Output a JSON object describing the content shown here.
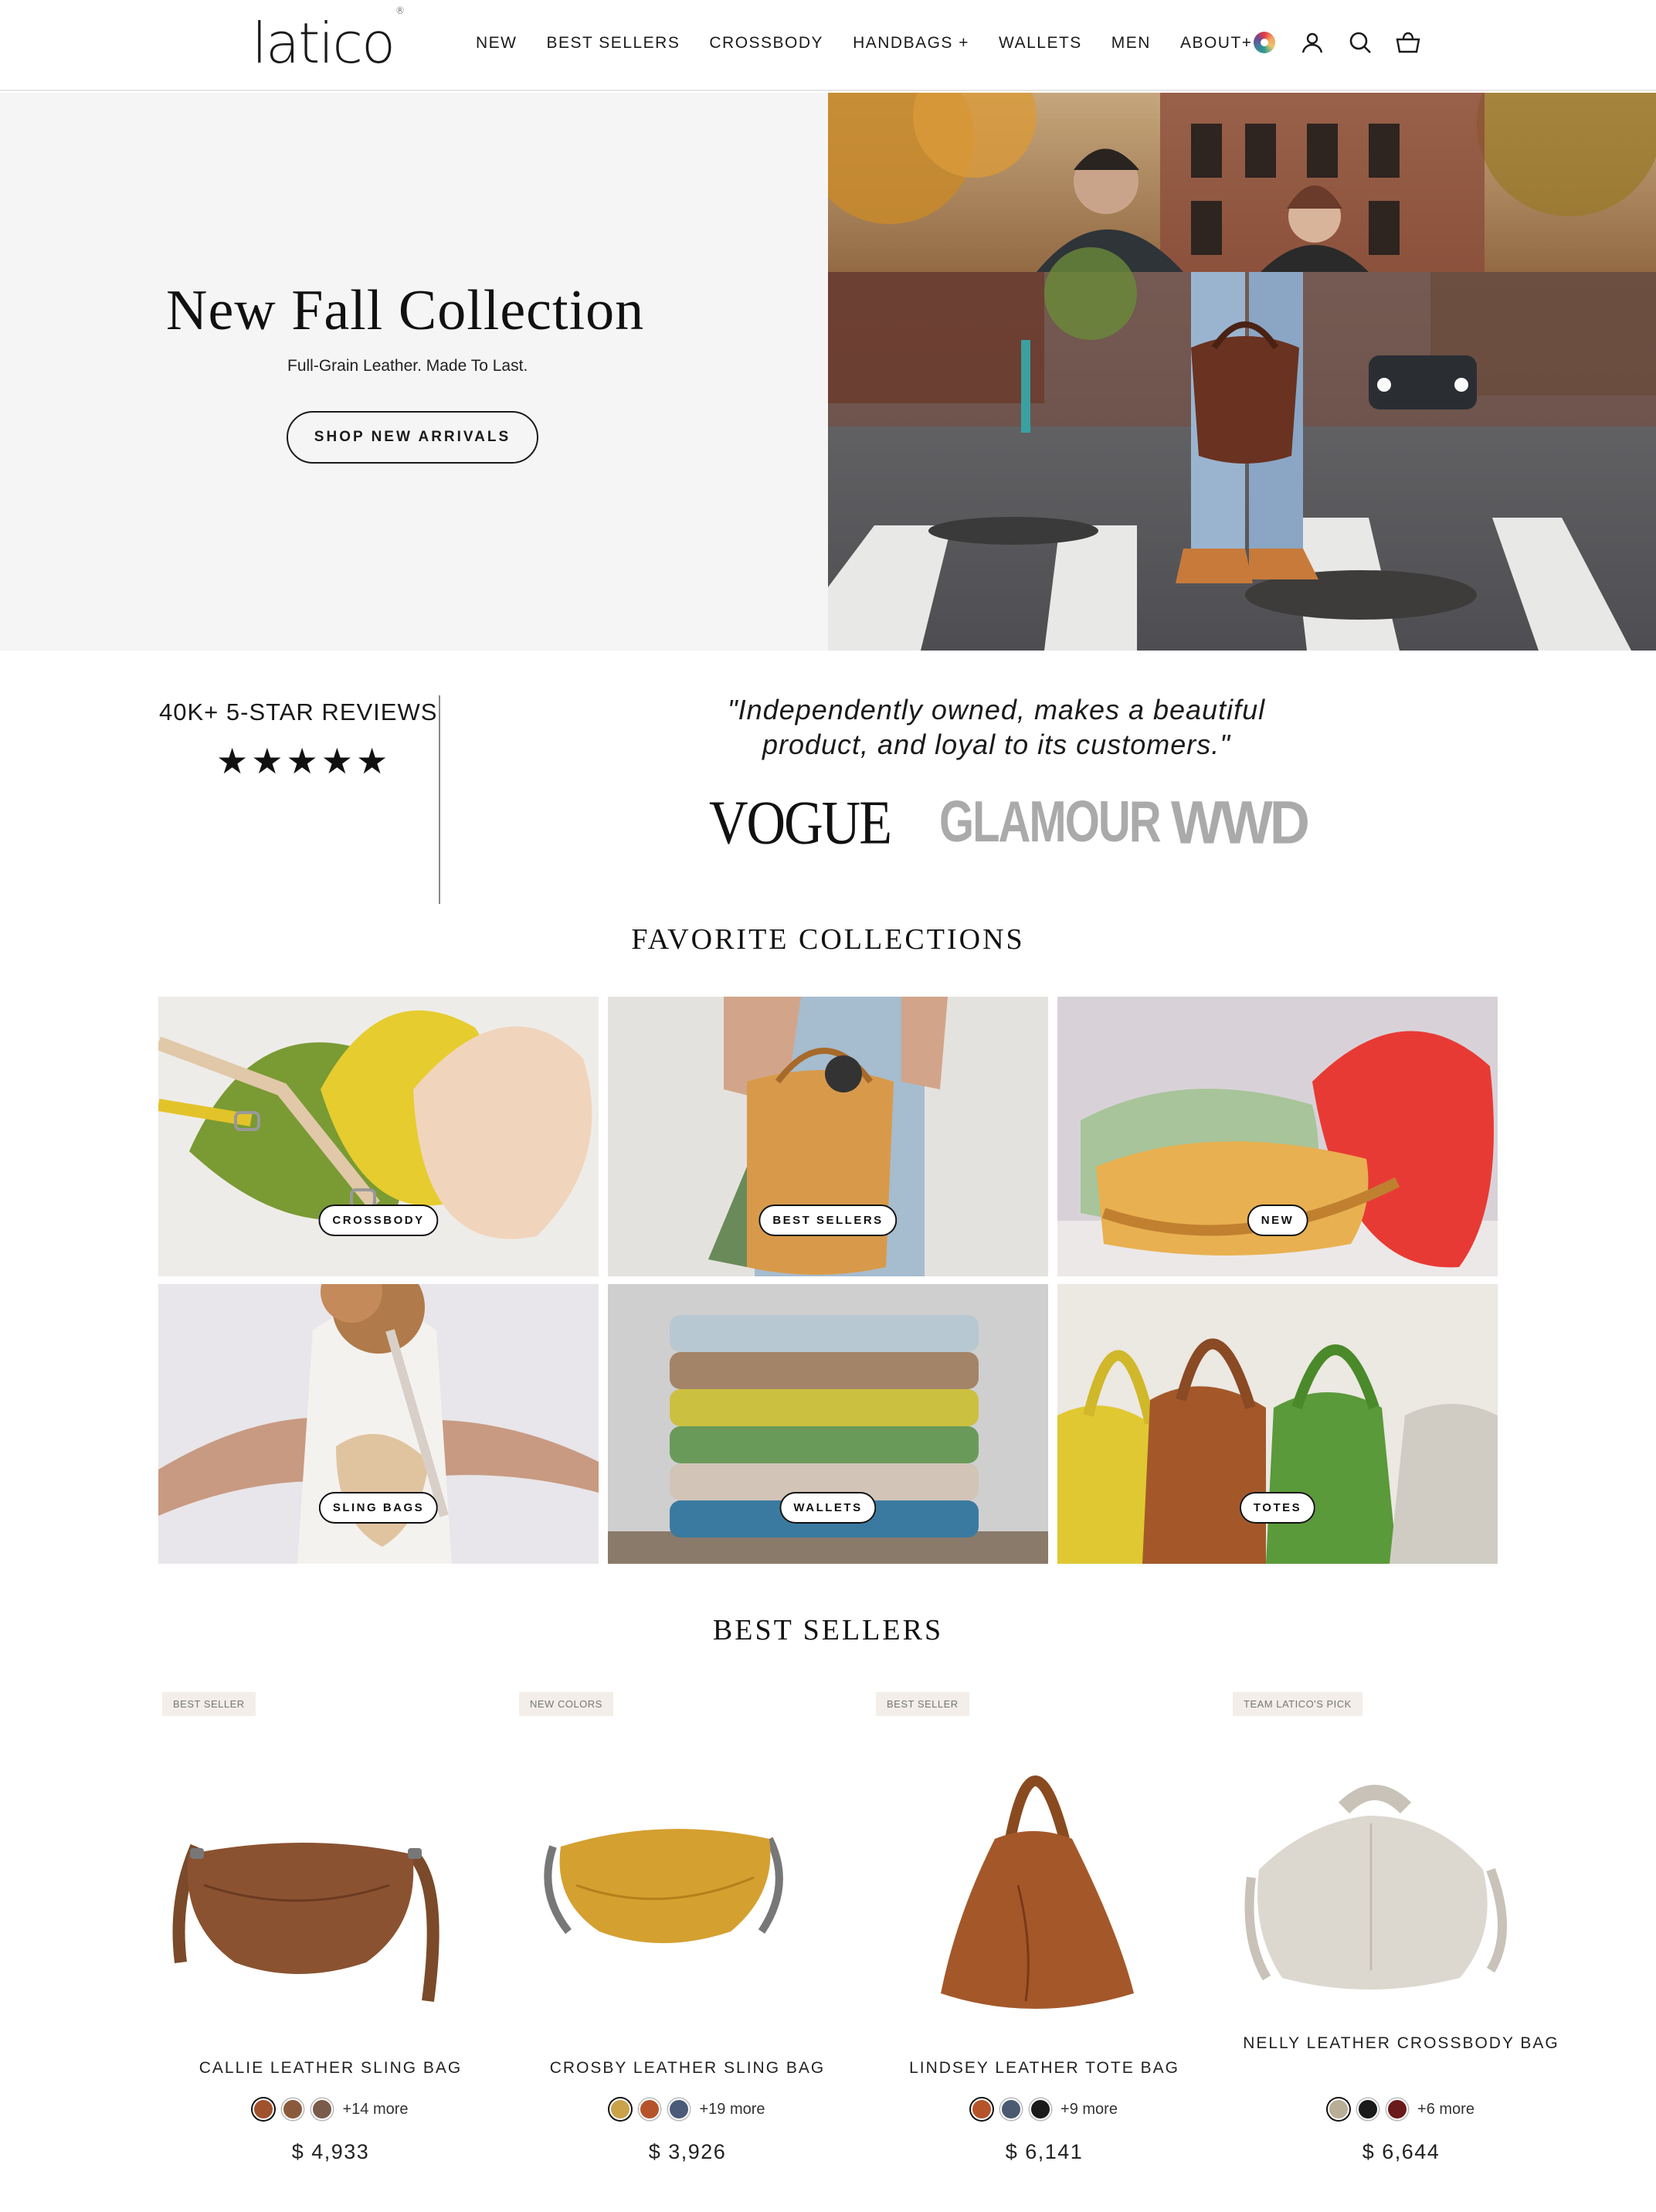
{
  "header": {
    "logo": "latico",
    "logo_mark": "®",
    "nav": [
      "NEW",
      "BEST SELLERS",
      "CROSSBODY",
      "HANDBAGS +",
      "WALLETS",
      "MEN",
      "ABOUT+"
    ],
    "icons": [
      "color-wheel-icon",
      "account-icon",
      "search-icon",
      "cart-icon"
    ]
  },
  "hero": {
    "title": "New Fall Collection",
    "subtitle": "Full-Grain Leather. Made To Last.",
    "cta": "SHOP NEW ARRIVALS"
  },
  "press": {
    "reviews": "40K+ 5-STAR REVIEWS",
    "stars": "★★★★★",
    "quote": "\"Independently owned, makes a beautiful product, and loyal to its customers.\"",
    "logos": [
      "VOGUE",
      "GLAMOUR",
      "WWD"
    ]
  },
  "collections": {
    "title": "FAVORITE COLLECTIONS",
    "items": [
      {
        "label": "CROSSBODY"
      },
      {
        "label": "BEST SELLERS"
      },
      {
        "label": "NEW"
      },
      {
        "label": "SLING BAGS"
      },
      {
        "label": "WALLETS"
      },
      {
        "label": "TOTES"
      }
    ]
  },
  "bestsellers": {
    "title": "BEST SELLERS",
    "products": [
      {
        "badge": "BEST SELLER",
        "name": "CALLIE LEATHER SLING BAG",
        "more": "+14 more",
        "price": "$ 4,933",
        "swatches": [
          "#a0522d",
          "#8b5a3c",
          "#7a5a4a"
        ]
      },
      {
        "badge": "NEW COLORS",
        "name": "CROSBY LEATHER SLING BAG",
        "more": "+19 more",
        "price": "$ 3,926",
        "swatches": [
          "#c9a24a",
          "#b5542a",
          "#4a5a78"
        ]
      },
      {
        "badge": "BEST SELLER",
        "name": "LINDSEY LEATHER TOTE BAG",
        "more": "+9 more",
        "price": "$ 6,141",
        "swatches": [
          "#b5542a",
          "#4a5a70",
          "#1a1a1a"
        ]
      },
      {
        "badge": "TEAM LATICO'S PICK",
        "name": "NELLY LEATHER CROSSBODY BAG",
        "more": "+6 more",
        "price": "$ 6,644",
        "swatches": [
          "#b8ad95",
          "#1a1a1a",
          "#6a1a1a"
        ]
      }
    ]
  }
}
